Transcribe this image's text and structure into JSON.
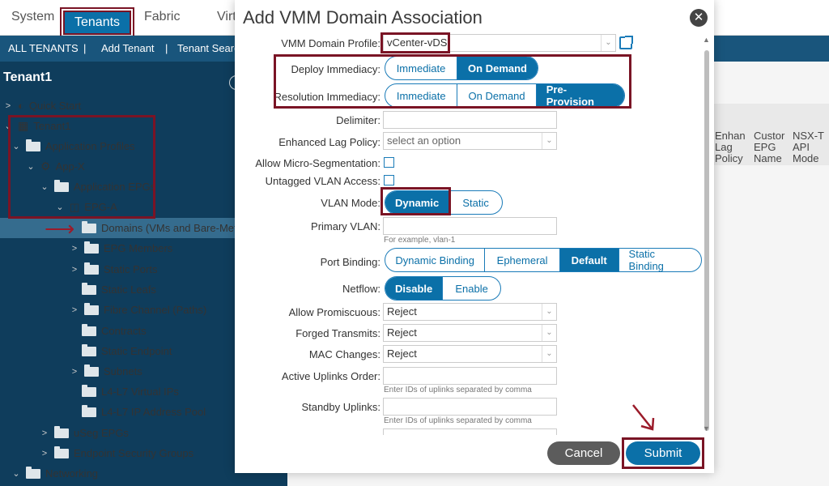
{
  "topnav": {
    "tabs": [
      "System",
      "Tenants",
      "Fabric",
      "Virt"
    ]
  },
  "subnav": {
    "items": [
      "ALL TENANTS",
      "|",
      "Add Tenant",
      "|",
      "Tenant Searc"
    ]
  },
  "sidebar": {
    "title": "Tenant1",
    "items": [
      {
        "label": "Quick Start"
      },
      {
        "label": "Tenant1"
      },
      {
        "label": "Application Profiles"
      },
      {
        "label": "App-X"
      },
      {
        "label": "Application EPGs"
      },
      {
        "label": "EPG-A"
      },
      {
        "label": "Domains (VMs and Bare-Meta"
      },
      {
        "label": "EPG Members"
      },
      {
        "label": "Static Ports"
      },
      {
        "label": "Static Leafs"
      },
      {
        "label": "Fibre Channel (Paths)"
      },
      {
        "label": "Contracts"
      },
      {
        "label": "Static Endpoint"
      },
      {
        "label": "Subnets"
      },
      {
        "label": "L4-L7 Virtual IPs"
      },
      {
        "label": "L4-L7 IP Address Pool"
      },
      {
        "label": "uSeg EPGs"
      },
      {
        "label": "Endpoint Security Groups"
      },
      {
        "label": "Networking"
      }
    ]
  },
  "background_columns": [
    "Enhan Lag Policy",
    "Custor EPG Name",
    "NSX-T API Mode"
  ],
  "modal": {
    "title": "Add VMM Domain Association",
    "vmm_profile_label": "VMM Domain Profile:",
    "vmm_profile_value": "vCenter-vDS",
    "deploy_label": "Deploy Immediacy:",
    "deploy_options": [
      "Immediate",
      "On Demand"
    ],
    "resolution_label": "Resolution Immediacy:",
    "resolution_options": [
      "Immediate",
      "On Demand",
      "Pre-Provision"
    ],
    "delimiter_label": "Delimiter:",
    "lag_label": "Enhanced Lag Policy:",
    "lag_placeholder": "select an option",
    "micro_label": "Allow Micro-Segmentation:",
    "untagged_label": "Untagged VLAN Access:",
    "vlan_mode_label": "VLAN Mode:",
    "vlan_mode_options": [
      "Dynamic",
      "Static"
    ],
    "primary_vlan_label": "Primary VLAN:",
    "primary_vlan_hint": "For example, vlan-1",
    "port_binding_label": "Port Binding:",
    "port_binding_options": [
      "Dynamic Binding",
      "Ephemeral",
      "Default",
      "Static Binding"
    ],
    "netflow_label": "Netflow:",
    "netflow_options": [
      "Disable",
      "Enable"
    ],
    "promiscuous_label": "Allow Promiscuous:",
    "promiscuous_value": "Reject",
    "forged_label": "Forged Transmits:",
    "forged_value": "Reject",
    "mac_label": "MAC Changes:",
    "mac_value": "Reject",
    "active_uplinks_label": "Active Uplinks Order:",
    "active_uplinks_hint": "Enter IDs of uplinks separated by comma",
    "standby_label": "Standby Uplinks:",
    "standby_hint": "Enter IDs of uplinks separated by comma",
    "cancel_label": "Cancel",
    "submit_label": "Submit"
  },
  "colors": {
    "accent": "#0b70a8",
    "annotation": "#7a1425",
    "sidebar": "#0f3d5c"
  }
}
